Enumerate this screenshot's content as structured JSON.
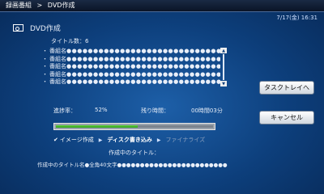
{
  "topbar": {
    "breadcrumb_root": "録画番組",
    "breadcrumb_sep": ">",
    "breadcrumb_current": "DVD作成"
  },
  "datetime": "7/17(金) 16:31",
  "page": {
    "title": "DVD作成",
    "title_count": "タイトル数：6"
  },
  "list": {
    "items": [
      {
        "bullet": "・",
        "label": "番組名",
        "dots": "●●●●●●●●●●●●●●●●●●●●●●●●●●●●●●"
      },
      {
        "bullet": "・",
        "label": "番組名",
        "dots": "●●●●●●●●●●●●●●●●●●●●●●●●●●●●●●"
      },
      {
        "bullet": "・",
        "label": "番組名",
        "dots": "●●●●●●●●●●●●●●●●●●●●●●●●●●●●●●"
      },
      {
        "bullet": "・",
        "label": "番組名",
        "dots": "●●●●●●●●●●●●●●●●●●●●●●●●●●●●●●"
      },
      {
        "bullet": "・",
        "label": "番組名",
        "dots": "●●●●●●●●●●●●●●●●●●●●●●●●●●●●●●"
      }
    ]
  },
  "scroll": {
    "up": "▲",
    "down": "▼"
  },
  "buttons": {
    "task_tray": "タスクトレイへ",
    "cancel": "キャンセル"
  },
  "progress": {
    "label": "進捗率：",
    "value": "52%",
    "fraction": 0.52,
    "remaining_label": "残り時間：",
    "remaining_value": "00時間03分",
    "fill_color": "#3fbf2a"
  },
  "steps": {
    "check": "✔",
    "image": "イメージ作成",
    "arrow": "▶",
    "disc": "ディスク書き込み",
    "finalize": "ファイナライズ"
  },
  "making": {
    "label": "作成中のタイトル：",
    "title": "作成中のタイトル名●全角40文字●●●●●●●●●●●●●●●●●●●●●●●●"
  },
  "colors": {
    "background": "#0d3f7c",
    "accent": "#3fbf2a"
  }
}
